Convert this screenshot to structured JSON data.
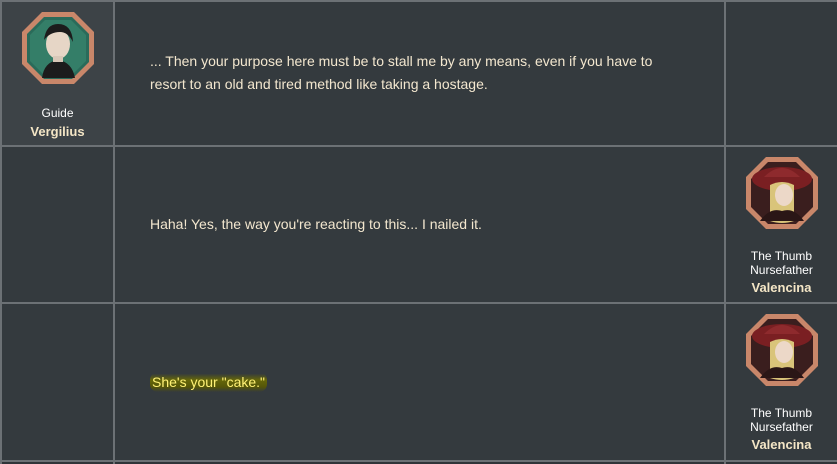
{
  "dialogue": [
    {
      "side": "left",
      "speaker": {
        "title_lines": [
          "Guide"
        ],
        "name": "Vergilius",
        "icon": "vergilius-portrait-icon"
      },
      "text": "... Then your purpose here must be to stall me by any means, even if you have to resort to an old and tired method like taking a hostage."
    },
    {
      "side": "right",
      "speaker": {
        "title_lines": [
          "The Thumb",
          "Nursefather"
        ],
        "name": "Valencina",
        "icon": "valencina-portrait-icon"
      },
      "text": "Haha! Yes, the way you're reacting to this... I nailed it."
    },
    {
      "side": "right",
      "speaker": {
        "title_lines": [
          "The Thumb",
          "Nursefather"
        ],
        "name": "Valencina",
        "icon": "valencina-portrait-icon"
      },
      "text": "She's your \"cake.\"",
      "highlighted": true
    }
  ],
  "colors": {
    "border": "#6c7175",
    "cell": "#343a3e",
    "text": "#f3e7cf",
    "name": "#f4e6c6",
    "highlight_text": "#fff176",
    "portrait_frame": "#c9876a",
    "portrait_hat": "#7a1f22"
  }
}
